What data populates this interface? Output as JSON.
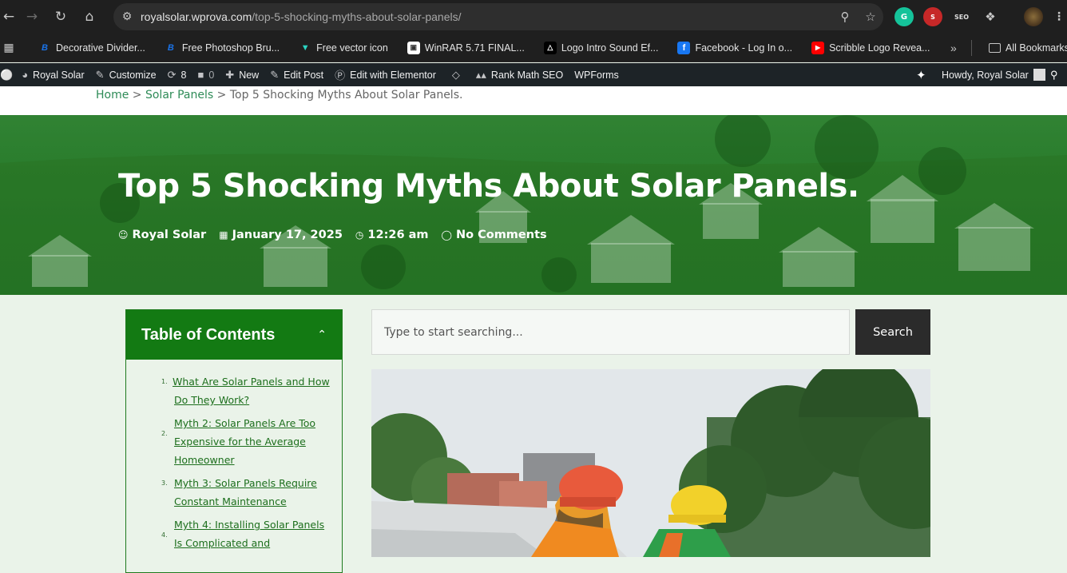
{
  "browser": {
    "url_host": "royalsolar.wprova.com",
    "url_path": "/top-5-shocking-myths-about-solar-panels/",
    "bookmarks": [
      {
        "label": "Decorative Divider...",
        "icon": "b-icon",
        "color": "#1a73e8"
      },
      {
        "label": "Free Photoshop Bru...",
        "icon": "b-icon",
        "color": "#1a73e8"
      },
      {
        "label": "Free vector icon",
        "icon": "vector-icon",
        "color": "#2bd4c2"
      },
      {
        "label": "WinRAR 5.71 FINAL...",
        "icon": "winrar-icon",
        "color": "#ffffff"
      },
      {
        "label": "Logo Intro Sound Ef...",
        "icon": "triangle-icon",
        "color": "#000000"
      },
      {
        "label": "Facebook - Log In o...",
        "icon": "facebook-icon",
        "color": "#1877f2"
      },
      {
        "label": "Scribble Logo Revea...",
        "icon": "youtube-icon",
        "color": "#ff0000"
      }
    ],
    "all_bookmarks": "All Bookmarks",
    "ext_seo_label": "SEO"
  },
  "admin_bar": {
    "site": "Royal Solar",
    "customize": "Customize",
    "updates": "8",
    "comments": "0",
    "new": "New",
    "edit_post": "Edit Post",
    "elementor": "Edit with Elementor",
    "rank_math": "Rank Math SEO",
    "wpforms": "WPForms",
    "howdy": "Howdy, Royal Solar"
  },
  "breadcrumb": {
    "home": "Home",
    "sep": ">",
    "category": "Solar Panels",
    "current": "Top 5 Shocking Myths About Solar Panels."
  },
  "post": {
    "title": "Top 5 Shocking Myths About Solar Panels.",
    "author": "Royal Solar",
    "date": "January 17, 2025",
    "time": "12:26 am",
    "comments": "No Comments"
  },
  "toc": {
    "title": "Table of Contents",
    "items": [
      {
        "num": "1.",
        "label": "What Are Solar Panels and How Do They Work?"
      },
      {
        "num": "2.",
        "label": "Myth 2: Solar Panels Are Too Expensive for the Average Homeowner"
      },
      {
        "num": "3.",
        "label": "Myth 3: Solar Panels Require Constant Maintenance"
      },
      {
        "num": "4.",
        "label": "Myth 4: Installing Solar Panels Is Complicated and"
      }
    ]
  },
  "search": {
    "placeholder": "Type to start searching...",
    "button": "Search"
  },
  "colors": {
    "brand_green": "#137a13",
    "link_green": "#2e8b57",
    "admin_bar": "#1d2327"
  }
}
